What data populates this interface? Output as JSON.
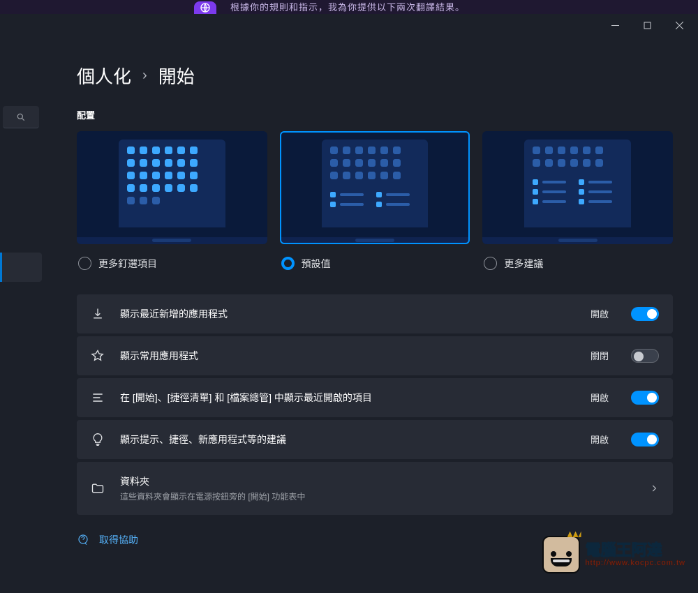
{
  "banner": {
    "text": "根據你的規則和指示，我為你提供以下兩次翻譯結果。"
  },
  "breadcrumb": {
    "parent": "個人化",
    "current": "開始"
  },
  "section_label": "配置",
  "layouts": [
    {
      "radio_label": "更多釘選項目",
      "selected": false
    },
    {
      "radio_label": "預設值",
      "selected": true
    },
    {
      "radio_label": "更多建議",
      "selected": false
    }
  ],
  "settings": [
    {
      "icon": "download",
      "title": "顯示最近新增的應用程式",
      "state_label": "開啟",
      "on": true,
      "type": "toggle"
    },
    {
      "icon": "star",
      "title": "顯示常用應用程式",
      "state_label": "關閉",
      "on": false,
      "type": "toggle"
    },
    {
      "icon": "list",
      "title": "在 [開始]、[捷徑清單] 和 [檔案總管] 中顯示最近開啟的項目",
      "state_label": "開啟",
      "on": true,
      "type": "toggle"
    },
    {
      "icon": "bulb",
      "title": "顯示提示、捷徑、新應用程式等的建議",
      "state_label": "開啟",
      "on": true,
      "type": "toggle"
    },
    {
      "icon": "folder",
      "title": "資料夾",
      "sub": "這些資料夾會顯示在電源按鈕旁的 [開始] 功能表中",
      "type": "nav"
    }
  ],
  "help": {
    "link_label": "取得協助"
  },
  "watermark": {
    "line1": "電腦王阿達",
    "line2": "http://www.kocpc.com.tw"
  }
}
